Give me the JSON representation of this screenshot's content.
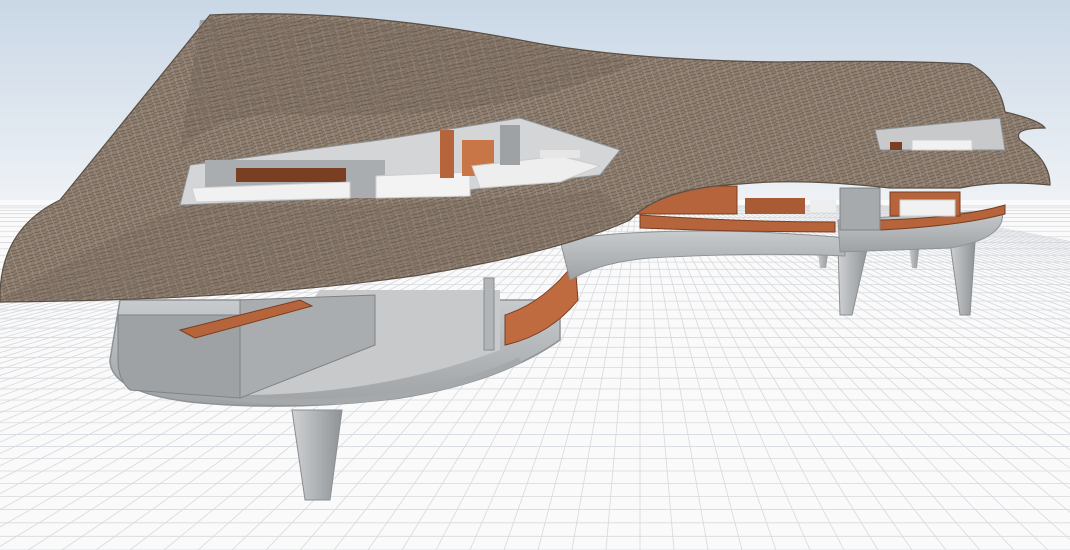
{
  "viewport": {
    "sky_top_color": "#c9d7e6",
    "sky_horizon_color": "#f4f6f8",
    "grid_floor_color": "#fafafa",
    "grid_line_color": "#d6d9de"
  },
  "model": {
    "thatch_color": "#8f7f70",
    "thatch_dark_color": "#5b4f45",
    "concrete_color": "#b9bcbf",
    "concrete_dark_color": "#8e9295",
    "wood_color": "#b5643c",
    "furniture_color": "#f1f1f1"
  }
}
